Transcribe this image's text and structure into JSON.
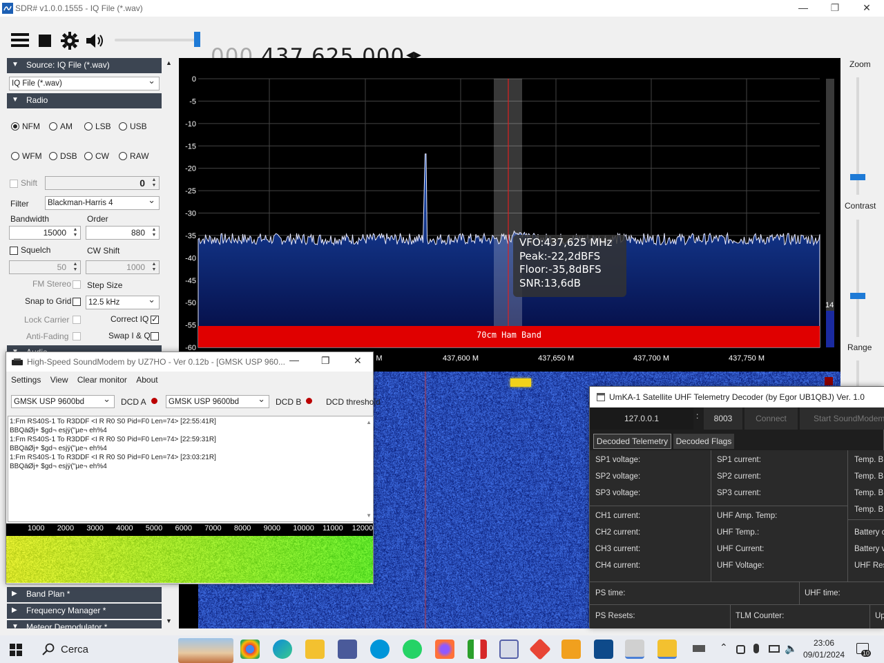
{
  "window": {
    "title": "SDR# v1.0.0.1555 - IQ File (*.wav)",
    "min": "—",
    "max": "❐",
    "close": "✕"
  },
  "toolbar": {
    "freq_dim": "000.",
    "freq_main": "437.625.000",
    "freq_arrows": "◂▸"
  },
  "left": {
    "source_header": "Source: IQ File (*.wav)",
    "source_value": "IQ File (*.wav)",
    "radio_header": "Radio",
    "modes": [
      "NFM",
      "AM",
      "LSB",
      "USB",
      "WFM",
      "DSB",
      "CW",
      "RAW"
    ],
    "shift_label": "Shift",
    "shift_value": "0",
    "filter_label": "Filter",
    "filter_value": "Blackman-Harris 4",
    "bandwidth_label": "Bandwidth",
    "bandwidth_value": "15000",
    "order_label": "Order",
    "order_value": "880",
    "squelch_label": "Squelch",
    "cwshift_label": "CW Shift",
    "squelch_value": "50",
    "cwshift_value": "1000",
    "fmstereo_label": "FM Stereo",
    "stepsize_label": "Step Size",
    "snap_label": "Snap to Grid",
    "step_value": "12.5 kHz",
    "lock_label": "Lock Carrier",
    "correctiq_label": "Correct IQ",
    "antifading_label": "Anti-Fading",
    "swapiq_label": "Swap I & Q",
    "audio_header": "Audio",
    "bandplan_header": "Band Plan *",
    "freqmgr_header": "Frequency Manager *",
    "meteor_header": "Meteor Demodulator *"
  },
  "spectrum": {
    "y_ticks": [
      "0",
      "-5",
      "-10",
      "-15",
      "-20",
      "-25",
      "-30",
      "-35",
      "-40",
      "-45",
      "-50",
      "-55",
      "-60"
    ],
    "x_ticks": [
      "M",
      "437,600 M",
      "437,650 M",
      "437,700 M",
      "437,750 M"
    ],
    "band_label": "70cm Ham Band",
    "vfo": "VFO:437,625 MHz",
    "peak": "Peak:-22,2dBFS",
    "floor": "Floor:-35,8dBFS",
    "snr": "SNR:13,6dB",
    "level_value": "14"
  },
  "right": {
    "zoom_label": "Zoom",
    "contrast_label": "Contrast",
    "range_label": "Range"
  },
  "soundmodem": {
    "title": "High-Speed SoundModem by UZ7HO - Ver 0.12b - [GMSK USP 960...",
    "menu": [
      "Settings",
      "View",
      "Clear monitor",
      "About"
    ],
    "mode_a": "GMSK USP 9600bd",
    "dcd_a": "DCD A",
    "mode_b": "GMSK USP 9600bd",
    "dcd_b": "DCD B",
    "dcd_threshold": "DCD threshold",
    "log": [
      "1:Fm RS40S-1 To R3DDF <I R R0 S0 Pid=F0 Len=74> [22:55:41R]",
      "BBQäØj+ $gd¬ esjÿ(\"µe¬ eh%4",
      "1:Fm RS40S-1 To R3DDF <I R R0 S0 Pid=F0 Len=74> [22:59:31R]",
      "BBQäØj+ $gd¬ esjÿ(\"µe¬ eh%4",
      "1:Fm RS40S-1 To R3DDF <I R R0 S0 Pid=F0 Len=74> [23:03:21R]",
      "BBQäØj+ $gd¬ esjÿ(\"µe¬ eh%4"
    ],
    "scale": [
      "1000",
      "2000",
      "3000",
      "4000",
      "5000",
      "6000",
      "7000",
      "8000",
      "9000",
      "10000",
      "11000",
      "12000"
    ]
  },
  "umka": {
    "title": "UmKA-1 Satellite UHF Telemetry Decoder (by Egor UB1QBJ) Ver. 1.0",
    "host": "127.0.0.1",
    "port": "8003",
    "connect": "Connect",
    "start": "Start SoundModem",
    "tab_telemetry": "Decoded Telemetry",
    "tab_flags": "Decoded Flags",
    "col1": [
      "SP1 voltage:",
      "SP2 voltage:",
      "SP3 voltage:",
      "CH1 current:",
      "CH2 current:",
      "CH3 current:",
      "CH4 current:"
    ],
    "col2": [
      "SP1 current:",
      "SP2 current:",
      "SP3 current:",
      "UHF Amp. Temp:",
      "UHF Temp.:",
      "UHF Current:",
      "UHF Voltage:"
    ],
    "col3": [
      "Temp. B",
      "Temp. B",
      "Temp. B",
      "Temp. B",
      "Battery c",
      "Battery v",
      "UHF Res"
    ],
    "ps_time": "PS time:",
    "uhf_time": "UHF time:",
    "ps_resets": "PS Resets:",
    "tlm_counter": "TLM Counter:",
    "up": "Up"
  },
  "taskbar": {
    "search": "Cerca",
    "time": "23:06",
    "date": "09/01/2024",
    "notif": "10"
  }
}
